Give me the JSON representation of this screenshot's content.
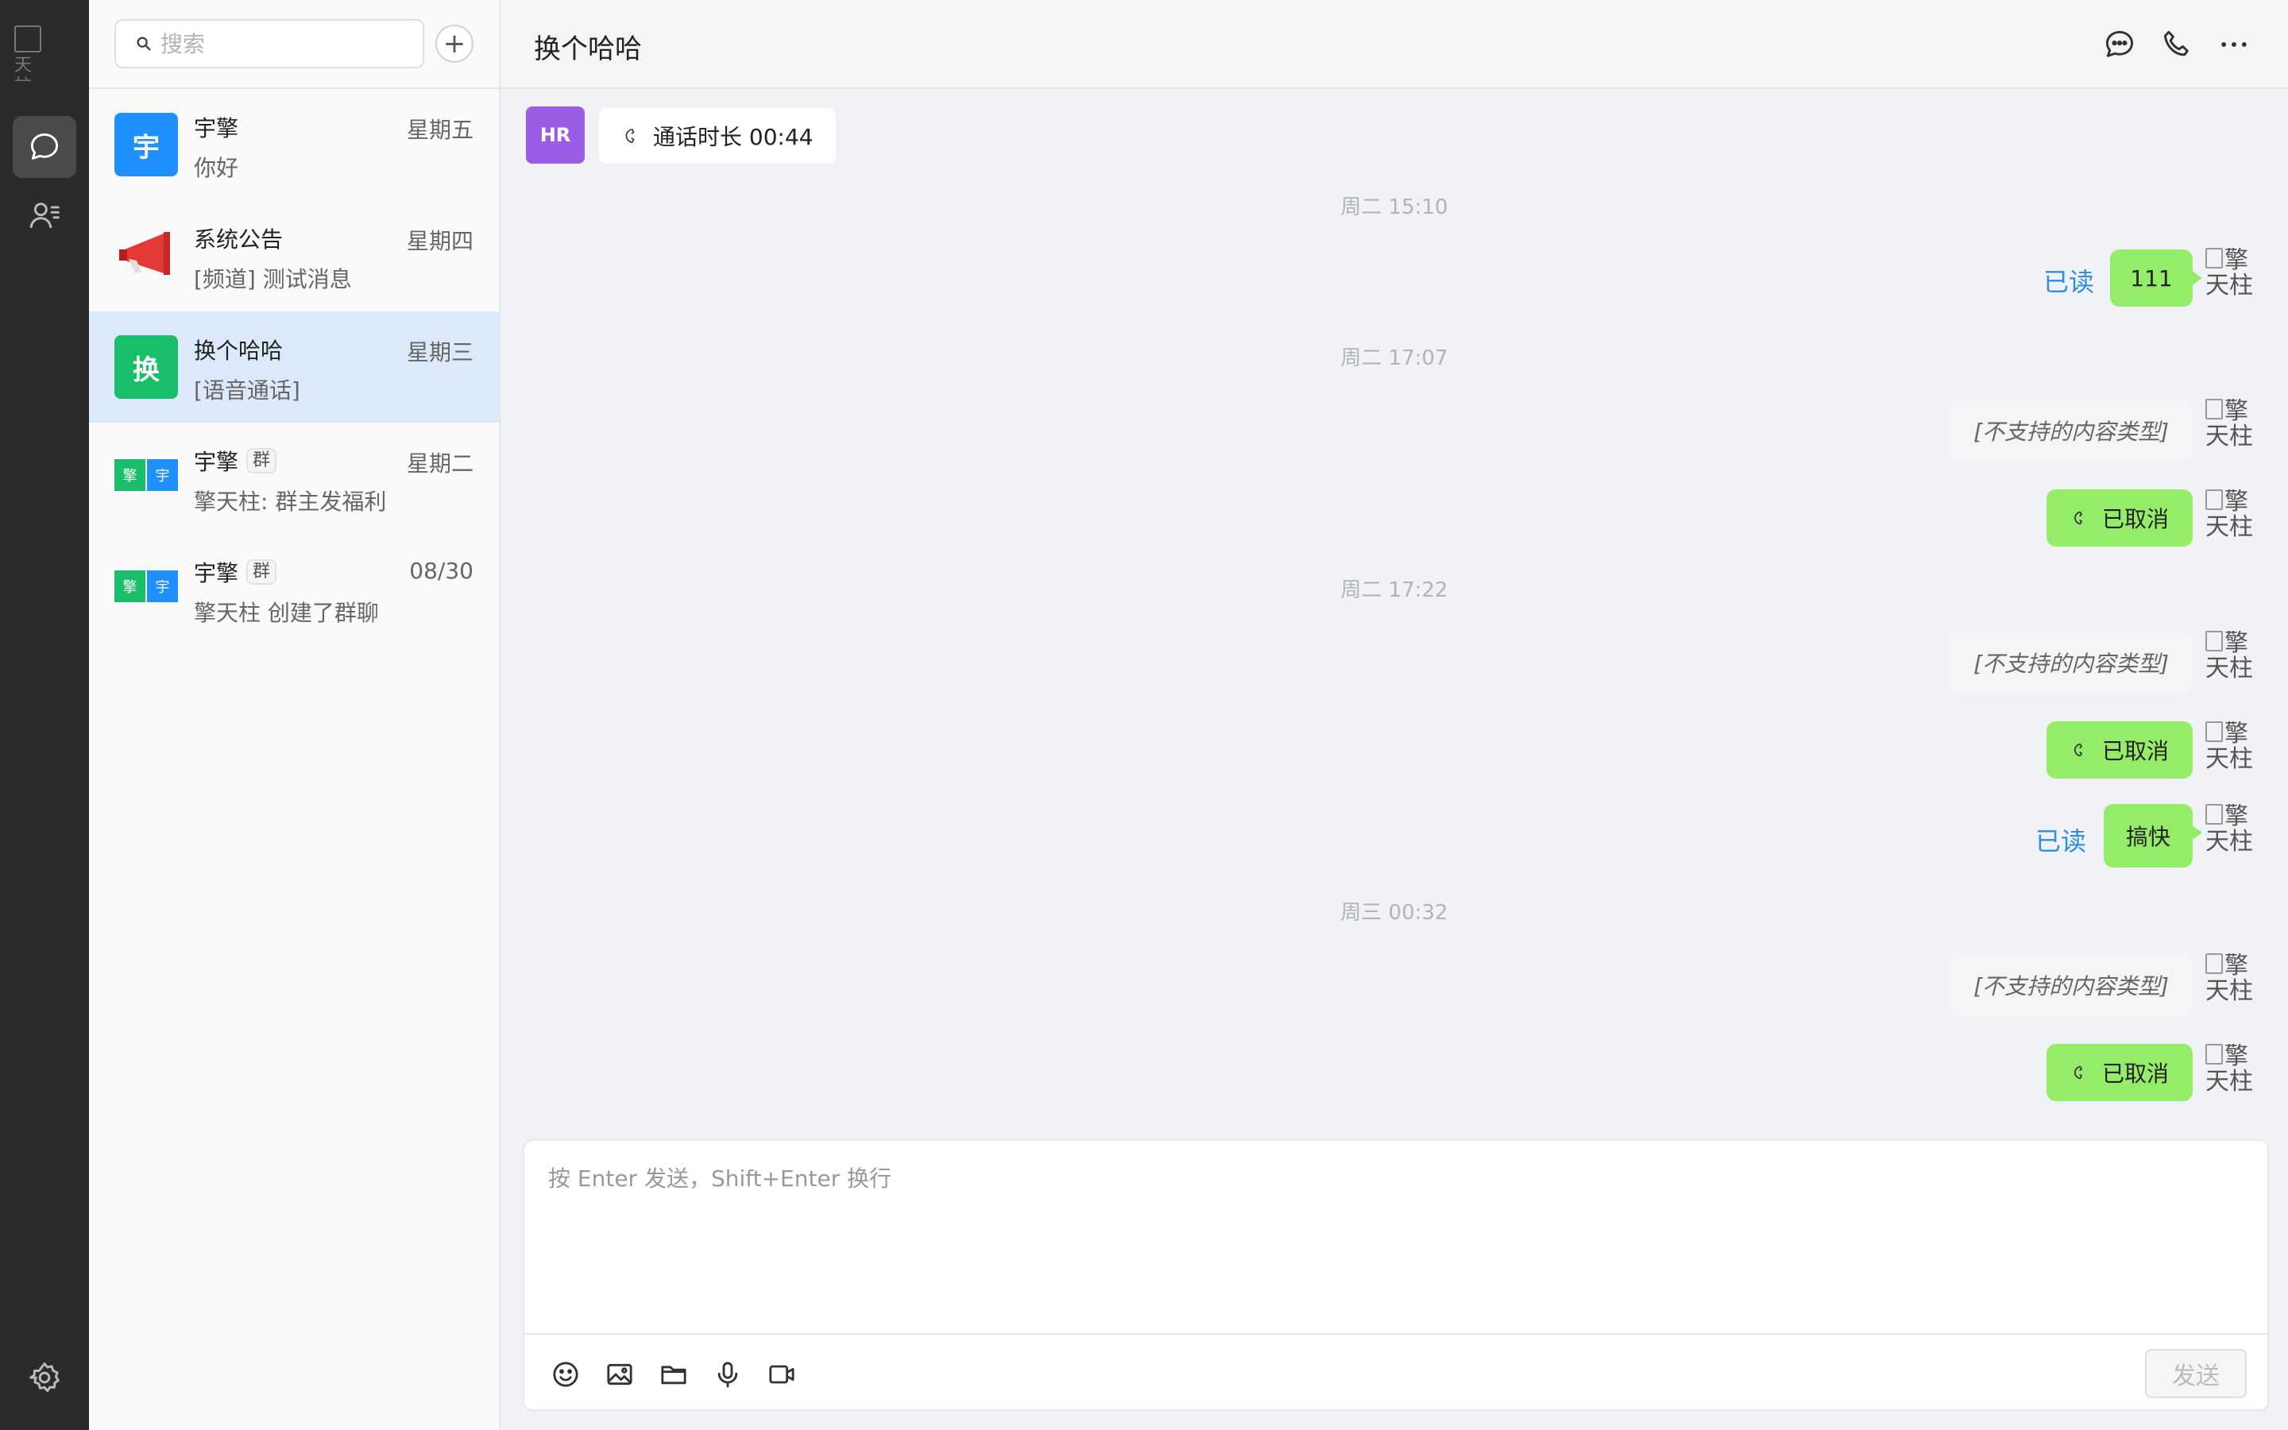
{
  "rail": {
    "profile_alt": "天柱"
  },
  "sidebar": {
    "search_placeholder": "搜索",
    "add_symbol": "+",
    "conversations": [
      {
        "name": "宇擎",
        "avatar_text": "宇",
        "avatar_color": "#1e90ff",
        "time": "星期五",
        "preview": "你好"
      },
      {
        "name": "系统公告",
        "avatar_icon": "megaphone-icon",
        "time": "星期四",
        "preview": "[频道] 测试消息"
      },
      {
        "name": "换个哈哈",
        "avatar_text": "换",
        "avatar_color": "#19be6b",
        "time": "星期三",
        "preview": "[语音通话]"
      },
      {
        "name": "宇擎",
        "tag": "群",
        "group_avatar": [
          "擎",
          "宇"
        ],
        "time": "星期二",
        "preview": "擎天柱: 群主发福利"
      },
      {
        "name": "宇擎",
        "tag": "群",
        "group_avatar": [
          "擎",
          "宇"
        ],
        "time": "08/30",
        "preview": "擎天柱 创建了群聊"
      }
    ]
  },
  "chat": {
    "title": "换个哈哈",
    "header_icons": [
      "chat-bubble-icon",
      "phone-icon",
      "more-icon"
    ],
    "first_message": {
      "avatar_text": "HR",
      "avatar_color": "#9b5de5",
      "text": "通话时长 00:44"
    },
    "timestamps": [
      "周二 15:10",
      "周二 17:07",
      "周二 17:22",
      "周三 00:32"
    ],
    "my_avatar_alt": "擎天柱",
    "read_label": "已读",
    "messages": [
      {
        "text": "111",
        "read": true
      },
      {
        "text": "[不支持的内容类型]"
      },
      {
        "text": "已取消",
        "call": true
      },
      {
        "text": "[不支持的内容类型]"
      },
      {
        "text": "已取消",
        "call": true
      },
      {
        "text": "搞快",
        "read": true
      },
      {
        "text": "[不支持的内容类型]"
      },
      {
        "text": "已取消",
        "call": true
      }
    ]
  },
  "composer": {
    "placeholder": "按 Enter 发送，Shift+Enter 换行",
    "send_label": "发送",
    "tools": [
      "emoji-icon",
      "image-icon",
      "folder-icon",
      "microphone-icon",
      "video-icon"
    ]
  },
  "colors": {
    "rail_bg": "#2b2b2b",
    "bubble_green": "#95ec69",
    "read_blue": "#2f8de4",
    "active_conv": "#dbe9fb"
  }
}
